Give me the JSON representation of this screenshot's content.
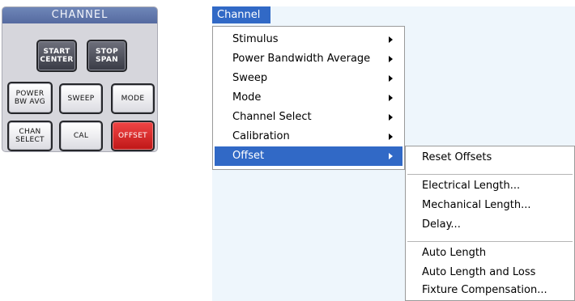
{
  "panel": {
    "title": "CHANNEL",
    "keys": {
      "start_center": [
        "START",
        "CENTER"
      ],
      "stop_span": [
        "STOP",
        "SPAN"
      ],
      "power_bw_avg": [
        "POWER",
        "BW AVG"
      ],
      "sweep": "SWEEP",
      "mode": "MODE",
      "chan_select": [
        "CHAN",
        "SELECT"
      ],
      "cal": "CAL",
      "offset": "OFFSET"
    }
  },
  "menubar": {
    "channel_label": "Channel"
  },
  "menu": {
    "items": [
      {
        "label": "Stimulus"
      },
      {
        "label": "Power Bandwidth Average"
      },
      {
        "label": "Sweep"
      },
      {
        "label": "Mode"
      },
      {
        "label": "Channel Select"
      },
      {
        "label": "Calibration"
      },
      {
        "label": "Offset"
      }
    ]
  },
  "submenu": {
    "items": [
      {
        "label": "Reset Offsets"
      },
      {
        "label": "Electrical Length..."
      },
      {
        "label": "Mechanical Length..."
      },
      {
        "label": "Delay..."
      },
      {
        "label": "Auto Length"
      },
      {
        "label": "Auto Length and Loss"
      },
      {
        "label": "Fixture Compensation..."
      }
    ]
  },
  "colors": {
    "highlight": "#3169c6",
    "panel_header": "#5b6ea6",
    "offset_key": "#dd2a2a",
    "canvas": "#eef6fc"
  }
}
